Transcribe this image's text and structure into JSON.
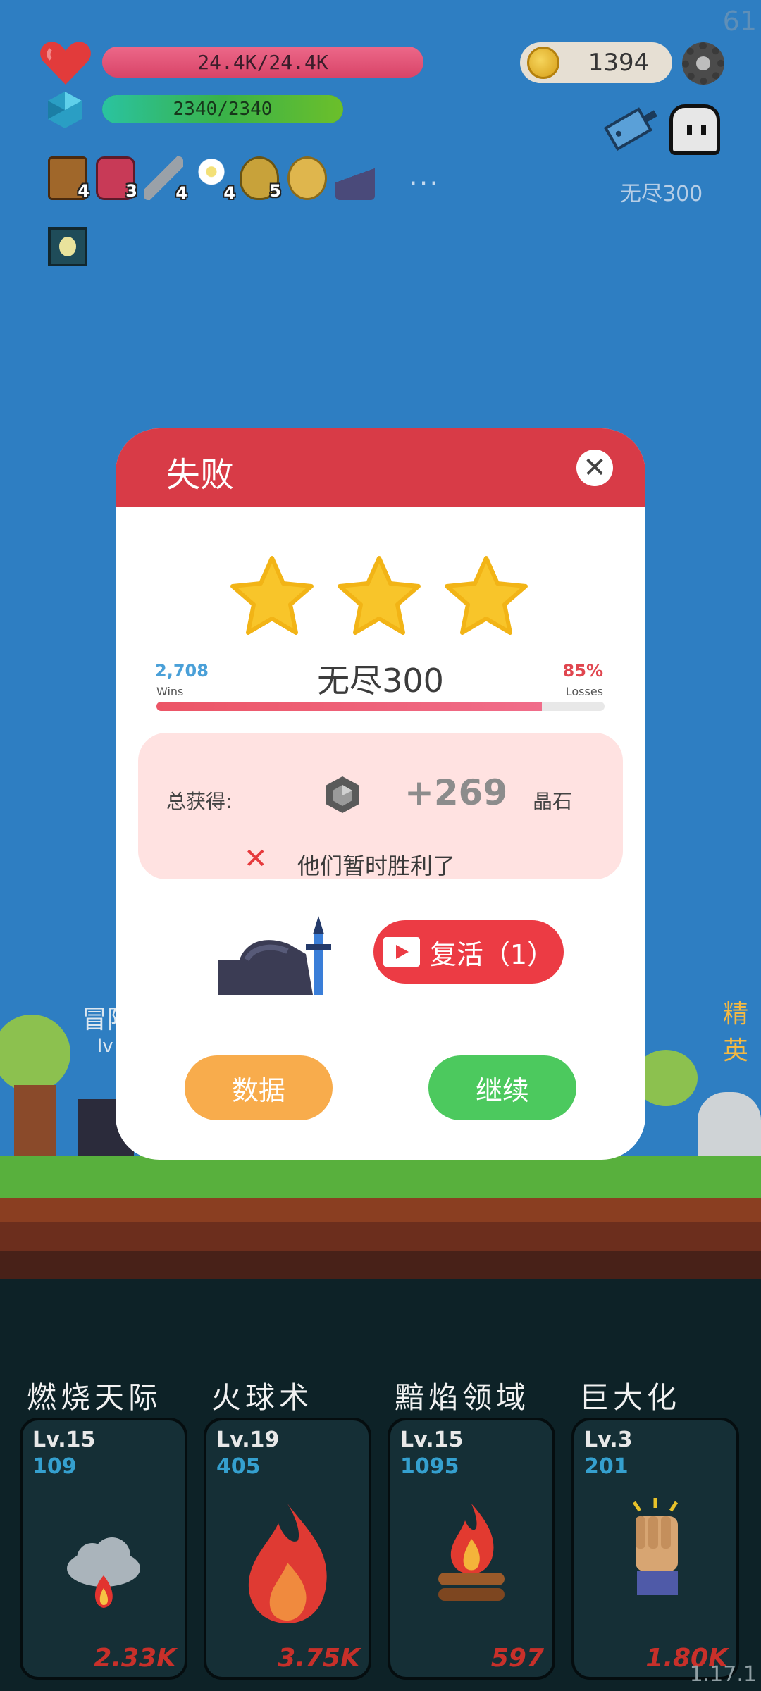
{
  "hud": {
    "fps": "61",
    "hp_text": "24.4K/24.4K",
    "hp_fraction": 1.0,
    "mp_text": "2340/2340",
    "mp_fraction": 1.0,
    "coins": "1394",
    "endless_label": "无尽300",
    "inventory": [
      {
        "icon": "book-icon",
        "count": "4"
      },
      {
        "icon": "jam-jar-icon",
        "count": "3"
      },
      {
        "icon": "sword-icon",
        "count": "4"
      },
      {
        "icon": "flower-icon",
        "count": "4"
      },
      {
        "icon": "golden-egg-icon",
        "count": "5"
      },
      {
        "icon": "cookie-icon",
        "count": ""
      },
      {
        "icon": "wizard-hat-icon",
        "count": ""
      }
    ],
    "more": "···"
  },
  "scene": {
    "left_label": "冒险",
    "left_sub": "lv",
    "right_label": "精英"
  },
  "modal": {
    "title": "失败",
    "stars": 3,
    "stage": "无尽300",
    "wins_value": "2,708",
    "wins_label": "Wins",
    "losses_value": "85%",
    "losses_label": "Losses",
    "progress": 0.86,
    "reward_label": "总获得:",
    "reward_value": "+269",
    "reward_unit": "晶石",
    "result_message": "他们暂时胜利了",
    "revive_label": "复活（1）",
    "data_button": "数据",
    "continue_button": "继续"
  },
  "skills": [
    {
      "name": "燃烧天际",
      "level": "Lv.15",
      "cost": "109",
      "damage": "2.33K",
      "icon": "cloud-fire-icon"
    },
    {
      "name": "火球术",
      "level": "Lv.19",
      "cost": "405",
      "damage": "3.75K",
      "icon": "flame-icon"
    },
    {
      "name": "黯焰领域",
      "level": "Lv.15",
      "cost": "1095",
      "damage": "597",
      "icon": "campfire-icon"
    },
    {
      "name": "巨大化",
      "level": "Lv.3",
      "cost": "201",
      "damage": "1.80K",
      "icon": "fist-icon"
    }
  ],
  "version": "1.17.1",
  "colors": {
    "sky": "#2e7ec2",
    "danger": "#d83b47",
    "gold": "#f8ac4c",
    "success": "#4cc95e"
  }
}
